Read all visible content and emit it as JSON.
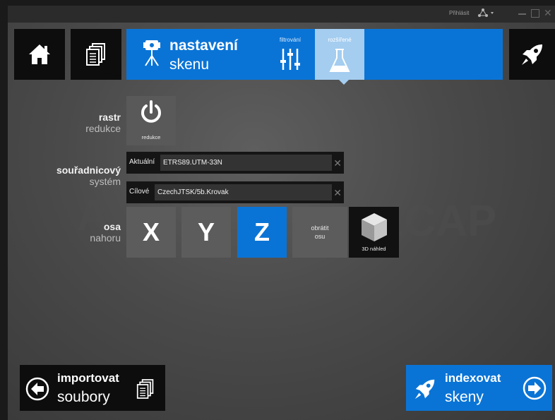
{
  "titlebar": {
    "login_label": "Přihlásit"
  },
  "header": {
    "title_bold": "nastavení",
    "title_light": "skenu",
    "tabs": [
      {
        "label": "filtrování",
        "icon": "sliders-icon",
        "active": false
      },
      {
        "label": "rozšířené",
        "icon": "flask-icon",
        "active": true
      }
    ]
  },
  "raster": {
    "label_bold": "rastr",
    "label_light": "redukce",
    "button_label": "redukce",
    "icon": "power-icon"
  },
  "coord_system": {
    "label_bold": "souřadnicový",
    "label_light": "systém",
    "current_prefix": "Aktuální",
    "current_value": "ETRS89.UTM-33N",
    "target_prefix": "Cílové",
    "target_value": "CzechJTSK/5b.Krovak"
  },
  "axis_up": {
    "label_bold": "osa",
    "label_light": "nahoru",
    "options": [
      "X",
      "Y",
      "Z"
    ],
    "selected": "Z",
    "flip_label_1": "obrátit",
    "flip_label_2": "osu",
    "preview_label": "3D náhled"
  },
  "watermark": {
    "left": "A",
    "right": "ECAP"
  },
  "footer": {
    "import_bold": "importovat",
    "import_light": "soubory",
    "index_bold": "indexovat",
    "index_light": "skeny"
  },
  "colors": {
    "accent": "#0a74d6",
    "tab_active": "#a4cdf0",
    "tile": "#5c5c5c",
    "dark": "#0d0d0d"
  }
}
